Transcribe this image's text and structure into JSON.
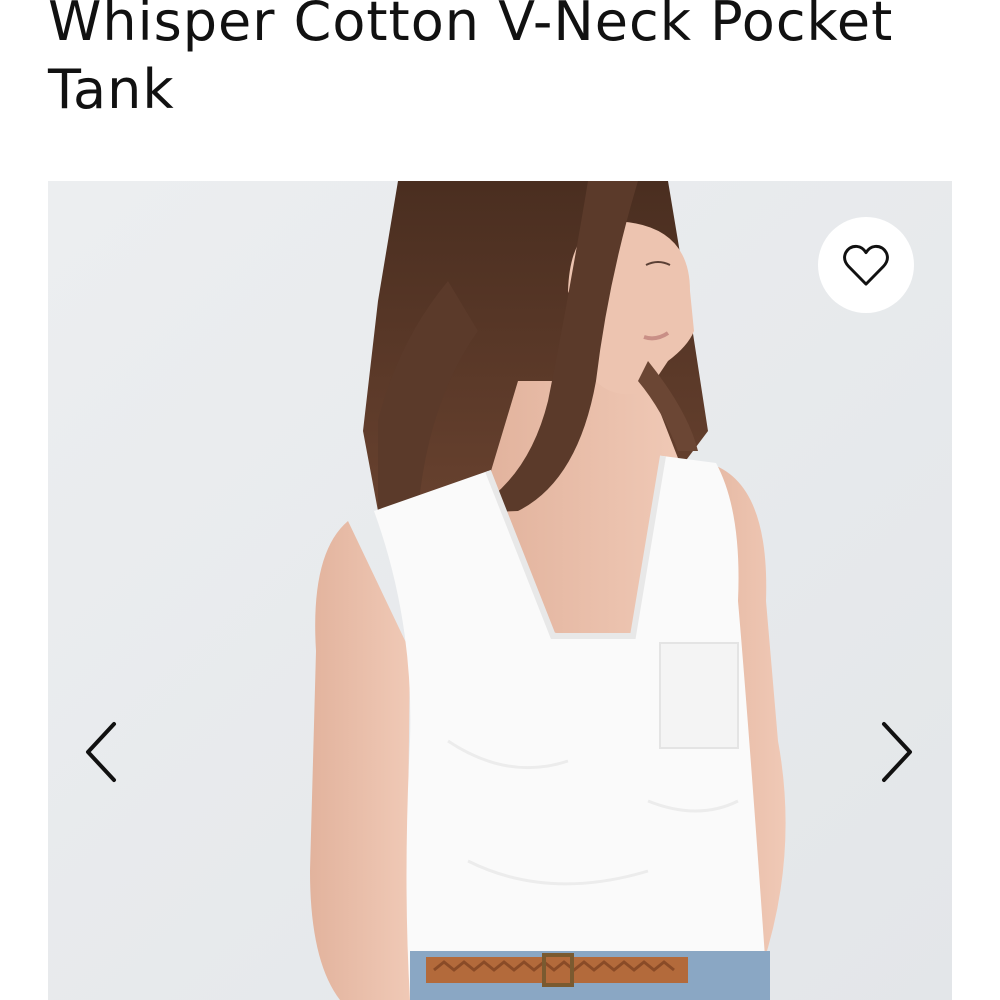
{
  "product": {
    "title": "Whisper Cotton V-Neck Pocket Tank"
  },
  "gallery": {
    "image_subject": "model wearing white v-neck pocket tank",
    "favorite_icon": "heart-outline-icon",
    "prev_icon": "chevron-left-icon",
    "next_icon": "chevron-right-icon"
  },
  "colors": {
    "title_text": "#111111",
    "gallery_background": "#e9ecee",
    "icon_stroke": "#111111",
    "favorite_button_bg": "#ffffff"
  }
}
